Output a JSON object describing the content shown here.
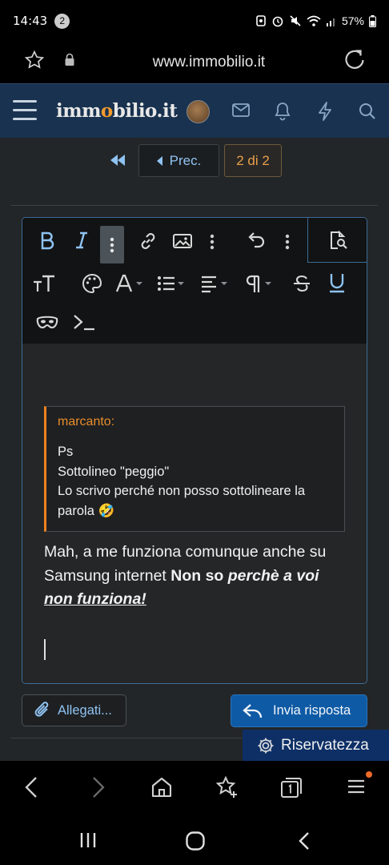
{
  "status_bar": {
    "time": "14:43",
    "notifications": "2",
    "battery": "57%"
  },
  "url_bar": {
    "url": "www.immobilio.it"
  },
  "header": {
    "logo_pre": "imm",
    "logo_o": "o",
    "logo_post": "bilio.it"
  },
  "pager": {
    "prev_label": "Prec.",
    "current_label": "2 di 2"
  },
  "quote": {
    "author": "marcanto:",
    "lines": [
      "Ps",
      "Sottolineo \"peggio\"",
      "Lo scrivo perché non posso sottolineare la",
      "parola 🤣"
    ]
  },
  "reply": {
    "plain": "Mah, a me funziona comunque anche su Samsung internet ",
    "bold": "Non so ",
    "bold_italic": "perchè a voi ",
    "bold_italic_underline": "non funziona! "
  },
  "buttons": {
    "attach_label": "Allegati...",
    "send_label": "Invia risposta",
    "privacy_label": "Riservatezza"
  },
  "colors": {
    "accent": "#8fc3f2",
    "brand_orange": "#f29a2e",
    "header_bg": "#18324f",
    "send_bg": "#0f5aa5"
  }
}
